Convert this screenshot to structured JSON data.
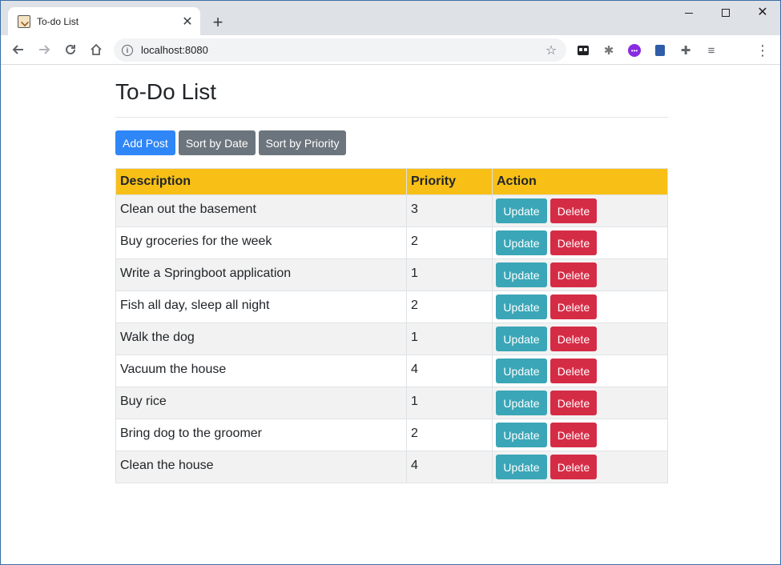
{
  "browser": {
    "tab_title": "To-do List",
    "tab_close": "✕",
    "new_tab": "+",
    "url": "localhost:8080",
    "controls": {
      "minimize": "",
      "maximize": "",
      "close": "✕"
    }
  },
  "page": {
    "title": "To-Do List",
    "buttons": {
      "add": "Add Post",
      "sort_date": "Sort by Date",
      "sort_priority": "Sort by Priority"
    },
    "table": {
      "headers": [
        "Description",
        "Priority",
        "Action"
      ],
      "update_label": "Update",
      "delete_label": "Delete",
      "rows": [
        {
          "description": "Clean out the basement",
          "priority": "3"
        },
        {
          "description": "Buy groceries for the week",
          "priority": "2"
        },
        {
          "description": "Write a Springboot application",
          "priority": "1"
        },
        {
          "description": "Fish all day, sleep all night",
          "priority": "2"
        },
        {
          "description": "Walk the dog",
          "priority": "1"
        },
        {
          "description": "Vacuum the house",
          "priority": "4"
        },
        {
          "description": "Buy rice",
          "priority": "1"
        },
        {
          "description": "Bring dog to the groomer",
          "priority": "2"
        },
        {
          "description": "Clean the house",
          "priority": "4"
        }
      ]
    }
  },
  "colors": {
    "primary": "#2f86f6",
    "secondary": "#6c757d",
    "header": "#f8c016",
    "info": "#3ba6b7",
    "danger": "#d52c46"
  }
}
